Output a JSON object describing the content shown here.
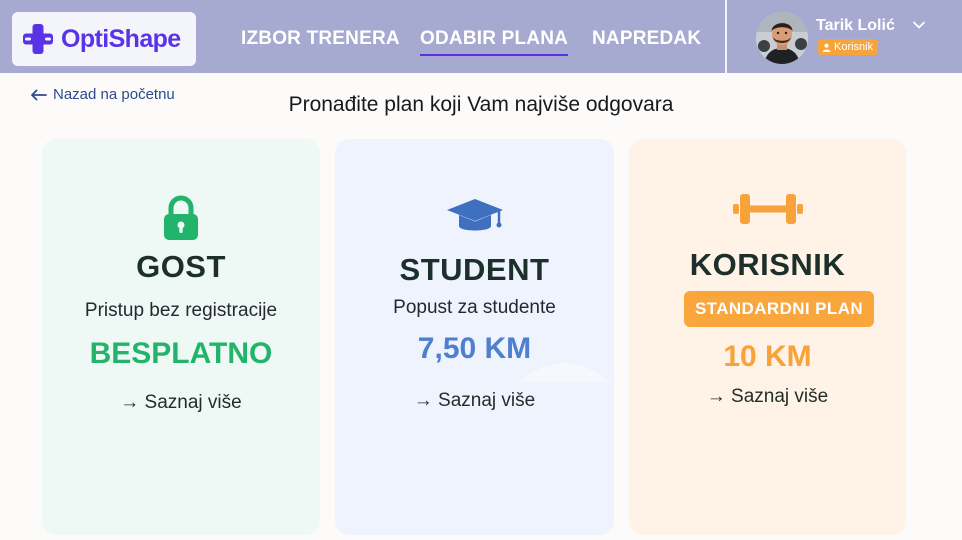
{
  "app": {
    "name": "OptiShape",
    "brand_color": "#5b33e6",
    "header_color": "#a7aad0"
  },
  "nav": {
    "items": [
      {
        "label": "IZBOR TRENERA",
        "active": false
      },
      {
        "label": "ODABIR PLANA",
        "active": true
      },
      {
        "label": "NAPREDAK",
        "active": false
      }
    ]
  },
  "user": {
    "name": "Tarik Lolić",
    "role": "Korisnik",
    "role_icon": "user-icon",
    "menu_icon": "chevron-down-icon"
  },
  "page": {
    "back_label": "Nazad na početnu",
    "back_icon": "arrow-left-icon",
    "title": "Pronađite plan koji Vam najviše odgovara"
  },
  "plans": [
    {
      "icon": "lock-icon",
      "name": "GOST",
      "description": "Pristup bez registracije",
      "price": "BESPLATNO",
      "price_color": "#22b46b",
      "cta": "→ Saznaj više"
    },
    {
      "icon": "graduation-cap-icon",
      "name": "STUDENT",
      "description": "Popust za studente",
      "price": "7,50 KM",
      "price_color": "#4f7fcf",
      "cta": "→ Saznaj više"
    },
    {
      "icon": "dumbbell-icon",
      "name": "KORISNIK",
      "tag": "STANDARDNI PLAN",
      "price": "10 KM",
      "price_color": "#f7a23a",
      "cta": "→ Saznaj više"
    }
  ]
}
